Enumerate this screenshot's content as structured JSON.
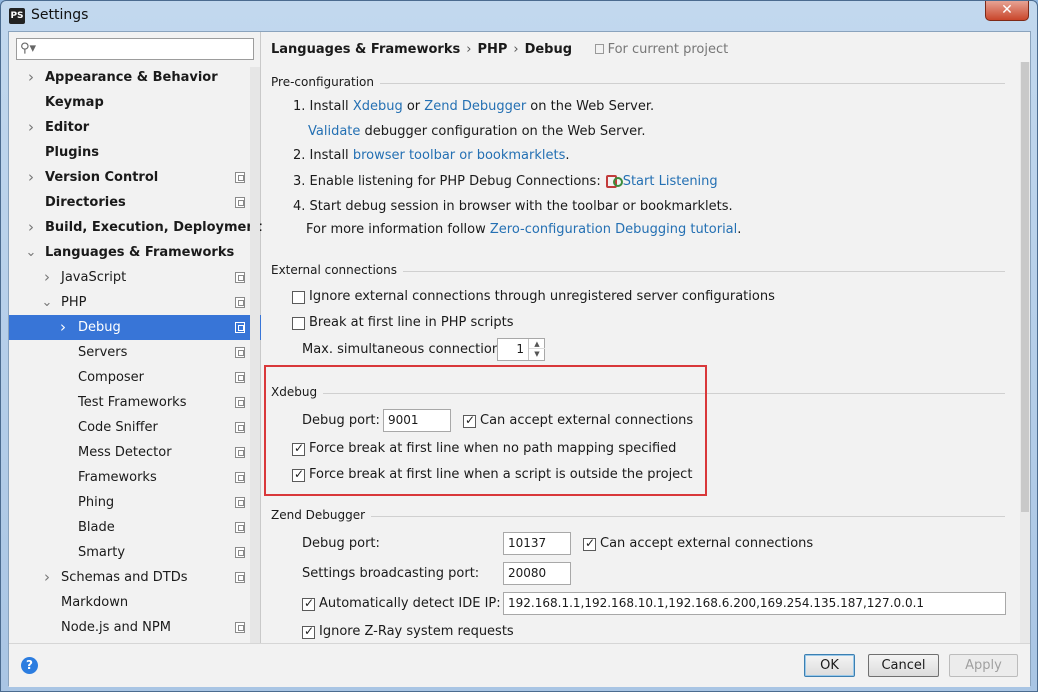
{
  "window": {
    "title": "Settings",
    "app_icon": "PS"
  },
  "search": {
    "placeholder": "",
    "value": ""
  },
  "sidebar": {
    "items": [
      {
        "label": "Appearance & Behavior",
        "level": 0,
        "bold": true,
        "arrow": "collapsed",
        "project": false
      },
      {
        "label": "Keymap",
        "level": 0,
        "bold": true,
        "arrow": "none",
        "project": false
      },
      {
        "label": "Editor",
        "level": 0,
        "bold": true,
        "arrow": "collapsed",
        "project": false
      },
      {
        "label": "Plugins",
        "level": 0,
        "bold": true,
        "arrow": "none",
        "project": false
      },
      {
        "label": "Version Control",
        "level": 0,
        "bold": true,
        "arrow": "collapsed",
        "project": true
      },
      {
        "label": "Directories",
        "level": 0,
        "bold": true,
        "arrow": "none",
        "project": true
      },
      {
        "label": "Build, Execution, Deployment",
        "level": 0,
        "bold": true,
        "arrow": "collapsed",
        "project": false
      },
      {
        "label": "Languages & Frameworks",
        "level": 0,
        "bold": true,
        "arrow": "expanded",
        "project": false
      },
      {
        "label": "JavaScript",
        "level": 1,
        "bold": false,
        "arrow": "collapsed",
        "project": true
      },
      {
        "label": "PHP",
        "level": 1,
        "bold": false,
        "arrow": "expanded",
        "project": true
      },
      {
        "label": "Debug",
        "level": 2,
        "bold": false,
        "arrow": "collapsed",
        "project": true,
        "selected": true
      },
      {
        "label": "Servers",
        "level": 2,
        "bold": false,
        "arrow": "none",
        "project": true
      },
      {
        "label": "Composer",
        "level": 2,
        "bold": false,
        "arrow": "none",
        "project": true
      },
      {
        "label": "Test Frameworks",
        "level": 2,
        "bold": false,
        "arrow": "none",
        "project": true
      },
      {
        "label": "Code Sniffer",
        "level": 2,
        "bold": false,
        "arrow": "none",
        "project": true
      },
      {
        "label": "Mess Detector",
        "level": 2,
        "bold": false,
        "arrow": "none",
        "project": true
      },
      {
        "label": "Frameworks",
        "level": 2,
        "bold": false,
        "arrow": "none",
        "project": true
      },
      {
        "label": "Phing",
        "level": 2,
        "bold": false,
        "arrow": "none",
        "project": true
      },
      {
        "label": "Blade",
        "level": 2,
        "bold": false,
        "arrow": "none",
        "project": true
      },
      {
        "label": "Smarty",
        "level": 2,
        "bold": false,
        "arrow": "none",
        "project": true
      },
      {
        "label": "Schemas and DTDs",
        "level": 1,
        "bold": false,
        "arrow": "collapsed",
        "project": true
      },
      {
        "label": "Markdown",
        "level": 1,
        "bold": false,
        "arrow": "none",
        "project": false
      },
      {
        "label": "Node.js and NPM",
        "level": 1,
        "bold": false,
        "arrow": "none",
        "project": true
      }
    ]
  },
  "breadcrumb": {
    "part1": "Languages & Frameworks",
    "part2": "PHP",
    "part3": "Debug",
    "sep": "›",
    "scope": "For current project"
  },
  "preconfig": {
    "header": "Pre-configuration",
    "step1_prefix": "1. Install ",
    "xdebug_link": "Xdebug",
    "or": " or ",
    "zend_link": "Zend Debugger",
    "step1_suffix": " on the Web Server.",
    "validate_link": "Validate",
    "validate_suffix": " debugger configuration on the Web Server.",
    "step2_prefix": "2. Install ",
    "toolbar_link": "browser toolbar or bookmarklets",
    "step2_suffix": ".",
    "step3_prefix": "3. Enable listening for PHP Debug Connections:",
    "start_listening_link": "Start Listening",
    "step4": "4. Start debug session in browser with the toolbar or bookmarklets.",
    "more_prefix": "For more information follow ",
    "tutorial_link": "Zero-configuration Debugging tutorial",
    "more_suffix": "."
  },
  "external": {
    "header": "External connections",
    "ignore_label": "Ignore external connections through unregistered server configurations",
    "ignore_checked": false,
    "break_label": "Break at first line in PHP scripts",
    "break_checked": false,
    "max_label": "Max. simultaneous connections:",
    "max_value": "1"
  },
  "xdebug": {
    "header": "Xdebug",
    "port_label": "Debug port:",
    "port_value": "9001",
    "accept_label": "Can accept external connections",
    "accept_checked": true,
    "force1_label": "Force break at first line when no path mapping specified",
    "force1_checked": true,
    "force2_label": "Force break at first line when a script is outside the project",
    "force2_checked": true
  },
  "zend": {
    "header": "Zend Debugger",
    "port_label": "Debug port:",
    "port_value": "10137",
    "accept_label": "Can accept external connections",
    "accept_checked": true,
    "broadcast_label": "Settings broadcasting port:",
    "broadcast_value": "20080",
    "detect_label": "Automatically detect IDE IP:",
    "detect_checked": true,
    "ip_value": "192.168.1.1,192.168.10.1,192.168.6.200,169.254.135.187,127.0.0.1",
    "zray_label": "Ignore Z-Ray system requests",
    "zray_checked": true
  },
  "buttons": {
    "help": "?",
    "ok": "OK",
    "cancel": "Cancel",
    "apply": "Apply"
  },
  "colors": {
    "link": "#2470b3",
    "selection": "#3875d7",
    "highlight_box": "#d9383a"
  }
}
